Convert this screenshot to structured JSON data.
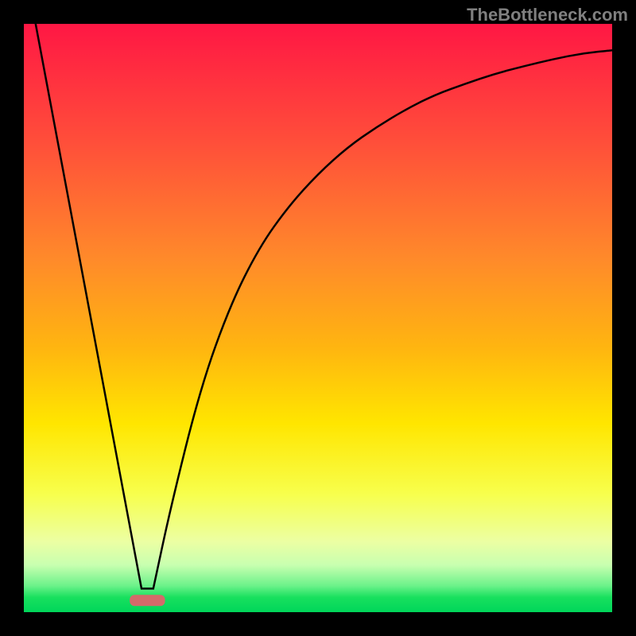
{
  "watermark": "TheBottleneck.com",
  "chart_data": {
    "type": "line",
    "title": "",
    "xlabel": "",
    "ylabel": "",
    "xlim": [
      0,
      100
    ],
    "ylim": [
      0,
      100
    ],
    "grid": false,
    "legend": false,
    "series": [
      {
        "name": "left-line",
        "x": [
          2,
          20
        ],
        "values": [
          100,
          4
        ]
      },
      {
        "name": "right-curve",
        "x": [
          22,
          25,
          30,
          35,
          40,
          45,
          50,
          55,
          60,
          65,
          70,
          75,
          80,
          85,
          90,
          95,
          100
        ],
        "values": [
          4,
          18,
          38,
          52,
          62,
          69,
          74.5,
          79,
          82.5,
          85.5,
          88,
          89.8,
          91.5,
          92.8,
          94,
          95,
          95.5
        ]
      }
    ],
    "marker": {
      "x_range": [
        18,
        24
      ],
      "y": 2,
      "color": "#d46a6a"
    },
    "gradient_stops": [
      {
        "offset": 0.0,
        "color": "#ff1744"
      },
      {
        "offset": 0.2,
        "color": "#ff4e3a"
      },
      {
        "offset": 0.4,
        "color": "#ff8a2a"
      },
      {
        "offset": 0.55,
        "color": "#ffb510"
      },
      {
        "offset": 0.68,
        "color": "#ffe600"
      },
      {
        "offset": 0.8,
        "color": "#f7ff4d"
      },
      {
        "offset": 0.88,
        "color": "#ecffa3"
      },
      {
        "offset": 0.92,
        "color": "#c8ffb0"
      },
      {
        "offset": 0.955,
        "color": "#6cf28a"
      },
      {
        "offset": 0.975,
        "color": "#18e05e"
      },
      {
        "offset": 1.0,
        "color": "#00d65a"
      }
    ]
  }
}
